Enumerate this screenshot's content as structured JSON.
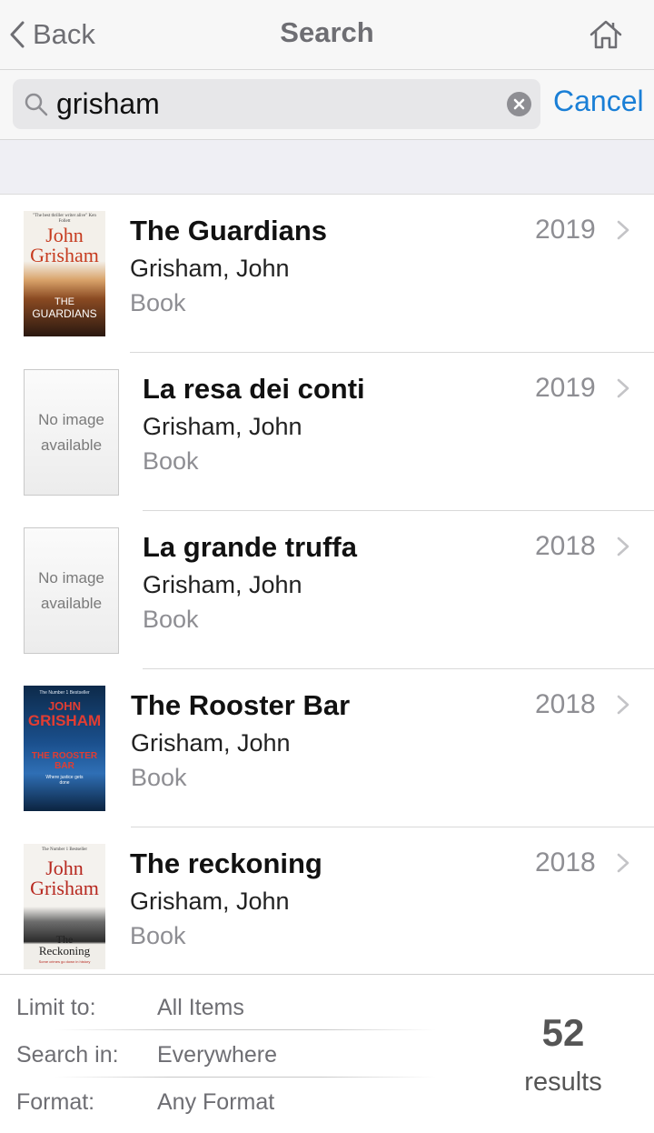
{
  "navbar": {
    "back_label": "Back",
    "title": "Search"
  },
  "search": {
    "query": "grisham",
    "cancel_label": "Cancel"
  },
  "results": [
    {
      "title": "The Guardians",
      "author": "Grisham, John",
      "format": "Book",
      "year": "2019",
      "cover": {
        "top": "\"The best thriller writer alive\" Ken Follett",
        "name1": "John",
        "name2": "Grisham",
        "sub1": "THE",
        "sub2": "GUARDIANS"
      }
    },
    {
      "title": "La resa dei conti",
      "author": "Grisham, John",
      "format": "Book",
      "year": "2019",
      "noimage": {
        "line1": "No image",
        "line2": "available"
      }
    },
    {
      "title": "La grande truffa",
      "author": "Grisham, John",
      "format": "Book",
      "year": "2018",
      "noimage": {
        "line1": "No image",
        "line2": "available"
      }
    },
    {
      "title": "The Rooster Bar",
      "author": "Grisham, John",
      "format": "Book",
      "year": "2018",
      "cover": {
        "top": "The Number 1 Bestseller",
        "name1": "JOHN",
        "name2": "GRISHAM",
        "sub1": "THE ROOSTER",
        "sub2": "BAR",
        "tag": "Where justice gets done"
      }
    },
    {
      "title": "The reckoning",
      "author": "Grisham, John",
      "format": "Book",
      "year": "2018",
      "cover": {
        "top": "The Number 1 Bestseller",
        "name1": "John",
        "name2": "Grisham",
        "sub1": "The",
        "sub2": "Reckoning",
        "tag": "Some crimes go down in history"
      }
    }
  ],
  "footer": {
    "limit_label": "Limit to:",
    "limit_value": "All Items",
    "searchin_label": "Search in:",
    "searchin_value": "Everywhere",
    "format_label": "Format:",
    "format_value": "Any Format",
    "count": "52",
    "count_label": "results"
  },
  "colors": {
    "accent": "#1a7fd6",
    "secondary_text": "#8e8e93",
    "nav_background": "#f7f7f7"
  }
}
